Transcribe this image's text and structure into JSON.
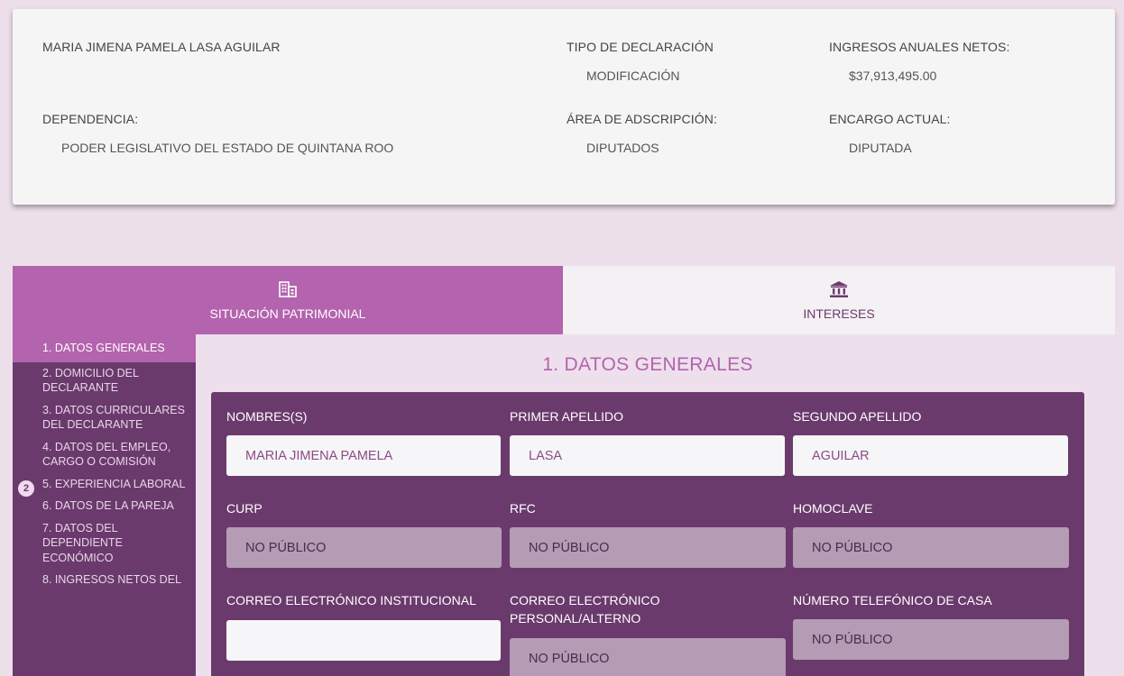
{
  "summary": {
    "name": "MARIA JIMENA PAMELA LASA AGUILAR",
    "tipo_label": "TIPO DE DECLARACIÓN",
    "tipo_value": "MODIFICACIÓN",
    "ingresos_label": "INGRESOS ANUALES NETOS:",
    "ingresos_value": "$37,913,495.00",
    "dependencia_label": "DEPENDENCIA:",
    "dependencia_value": "PODER LEGISLATIVO DEL ESTADO DE QUINTANA ROO",
    "area_label": "ÁREA DE ADSCRIPCIÓN:",
    "area_value": "DIPUTADOS",
    "encargo_label": "ENCARGO ACTUAL:",
    "encargo_value": "DIPUTADA"
  },
  "tabs": [
    {
      "label": "SITUACIÓN PATRIMONIAL",
      "icon": "building-icon",
      "active": true
    },
    {
      "label": "INTERESES",
      "icon": "institution-icon",
      "active": false
    }
  ],
  "sidebar": {
    "items": [
      {
        "label": "1. DATOS GENERALES"
      },
      {
        "label": "2. DOMICILIO DEL DECLARANTE"
      },
      {
        "label": "3. DATOS CURRICULARES DEL DECLARANTE"
      },
      {
        "label": "4. DATOS DEL EMPLEO, CARGO O COMISIÓN"
      },
      {
        "label": "5. EXPERIENCIA LABORAL",
        "badge": "2"
      },
      {
        "label": "6. DATOS DE LA PAREJA"
      },
      {
        "label": "7. DATOS DEL DEPENDIENTE ECONÓMICO"
      },
      {
        "label": "8. INGRESOS NETOS DEL"
      }
    ]
  },
  "main": {
    "title": "1. DATOS GENERALES",
    "fields": {
      "nombres": {
        "label": "NOMBRES(S)",
        "value": "MARIA JIMENA PAMELA"
      },
      "primer_apellido": {
        "label": "PRIMER APELLIDO",
        "value": "LASA"
      },
      "segundo_apellido": {
        "label": "SEGUNDO APELLIDO",
        "value": "AGUILAR"
      },
      "curp": {
        "label": "CURP",
        "value": "NO PÚBLICO"
      },
      "rfc": {
        "label": "RFC",
        "value": "NO PÚBLICO"
      },
      "homoclave": {
        "label": "HOMOCLAVE",
        "value": "NO PÚBLICO"
      },
      "correo_institucional": {
        "label": "CORREO ELECTRÓNICO INSTITUCIONAL",
        "value": ""
      },
      "correo_personal": {
        "label": "CORREO ELECTRÓNICO PERSONAL/ALTERNO",
        "value": "NO PÚBLICO"
      },
      "telefono_casa": {
        "label": "NÚMERO TELEFÓNICO DE CASA",
        "value": "NO PÚBLICO"
      }
    }
  },
  "colors": {
    "accent": "#b463ae",
    "panel": "#6b3a6d",
    "background": "#ecdfea"
  }
}
